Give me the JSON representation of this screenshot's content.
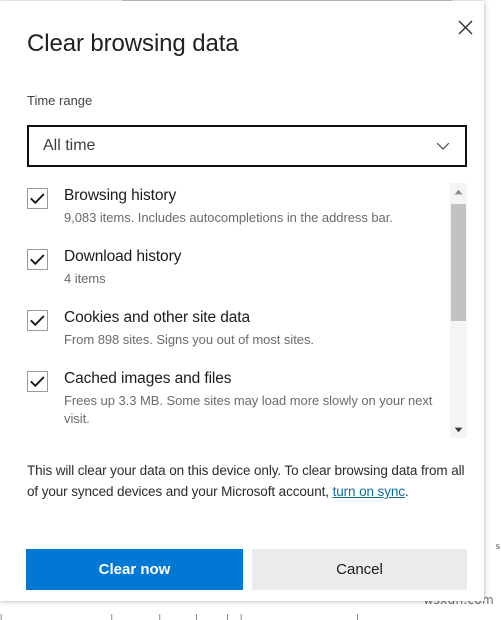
{
  "background": {
    "right_edge_char": "s",
    "bottom_text": "|___________________|________|______|_____|__|____________________|",
    "watermark": "wsxdn.com"
  },
  "dialog": {
    "title": "Clear browsing data",
    "close_icon": "close-icon",
    "time_range": {
      "label": "Time range",
      "selected": "All time",
      "chevron_icon": "chevron-down-icon",
      "options": [
        "All time"
      ]
    },
    "items": [
      {
        "id": "browsing-history",
        "label": "Browsing history",
        "description": "9,083 items. Includes autocompletions in the address bar.",
        "checked": true
      },
      {
        "id": "download-history",
        "label": "Download history",
        "description": "4 items",
        "checked": true
      },
      {
        "id": "cookies-and-other-site-data",
        "label": "Cookies and other site data",
        "description": "From 898 sites. Signs you out of most sites.",
        "checked": true
      },
      {
        "id": "cached-images-and-files",
        "label": "Cached images and files",
        "description": "Frees up 3.3 MB. Some sites may load more slowly on your next visit.",
        "checked": true
      }
    ],
    "scrollbar": {
      "up_icon": "scroll-up-arrow-icon",
      "down_icon": "scroll-down-arrow-icon"
    },
    "note": {
      "text_before": "This will clear your data on this device only. To clear browsing data from all of your synced devices and your Microsoft account, ",
      "link_text": "turn on sync",
      "text_after": "."
    },
    "actions": {
      "primary_label": "Clear now",
      "secondary_label": "Cancel"
    }
  },
  "colors": {
    "accent": "#0078d4",
    "link": "#0d6e9e",
    "secondary_button": "#ebebeb",
    "scrollbar_thumb": "#c2c2c2",
    "scrollbar_track": "#f4f4f4"
  }
}
